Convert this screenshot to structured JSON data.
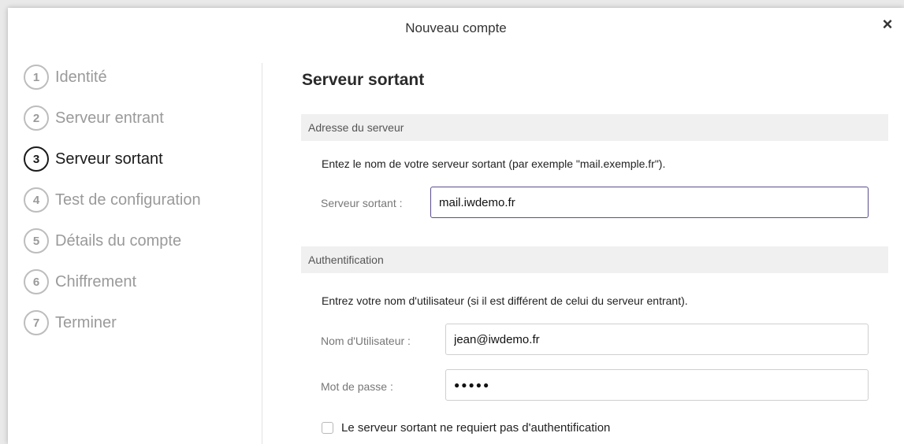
{
  "window": {
    "title": "Nouveau compte",
    "close_glyph": "×"
  },
  "sidebar": {
    "steps": [
      {
        "number": "1",
        "label": "Identité",
        "active": false
      },
      {
        "number": "2",
        "label": "Serveur entrant",
        "active": false
      },
      {
        "number": "3",
        "label": "Serveur sortant",
        "active": true
      },
      {
        "number": "4",
        "label": "Test de configuration",
        "active": false
      },
      {
        "number": "5",
        "label": "Détails du compte",
        "active": false
      },
      {
        "number": "6",
        "label": "Chiffrement",
        "active": false
      },
      {
        "number": "7",
        "label": "Terminer",
        "active": false
      }
    ]
  },
  "main": {
    "heading": "Serveur sortant",
    "server_section": {
      "title": "Adresse du serveur",
      "description": "Entez le nom de votre serveur sortant (par exemple \"mail.exemple.fr\").",
      "field_label": "Serveur sortant :",
      "field_value": "mail.iwdemo.fr"
    },
    "auth_section": {
      "title": "Authentification",
      "description": "Entrez votre nom d'utilisateur (si il est différent de celui du serveur entrant).",
      "username_label": "Nom d'Utilisateur :",
      "username_value": "jean@iwdemo.fr",
      "password_label": "Mot de passe :",
      "password_value": "●●●●●",
      "no_auth_label": "Le serveur sortant ne requiert pas d'authentification",
      "no_auth_checked": false
    }
  },
  "colors": {
    "focus_border": "#5b4d8c",
    "inactive_step": "#9a9a9a",
    "active_step": "#1a1a1a"
  }
}
